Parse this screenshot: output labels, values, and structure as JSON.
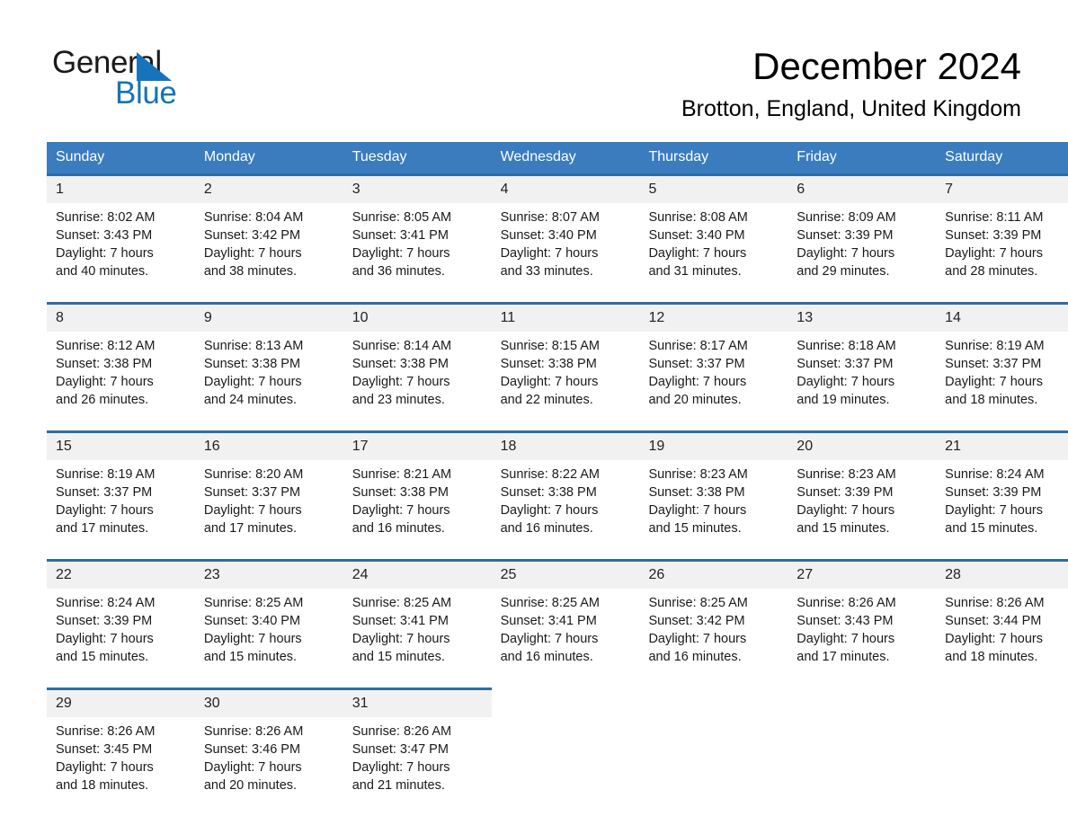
{
  "brand": {
    "name_part1": "General",
    "name_part2": "Blue",
    "triangle_color": "#1574bb"
  },
  "header": {
    "month_title": "December 2024",
    "location": "Brotton, England, United Kingdom"
  },
  "colors": {
    "header_blue": "#3a7cbe",
    "row_border_blue": "#2e6da4",
    "daynum_bg": "#f1f1f1",
    "brand_blue": "#1574bb"
  },
  "calendar": {
    "weekday_headers": [
      "Sunday",
      "Monday",
      "Tuesday",
      "Wednesday",
      "Thursday",
      "Friday",
      "Saturday"
    ],
    "weeks": [
      [
        {
          "day": "1",
          "sunrise": "Sunrise: 8:02 AM",
          "sunset": "Sunset: 3:43 PM",
          "daylight1": "Daylight: 7 hours",
          "daylight2": "and 40 minutes."
        },
        {
          "day": "2",
          "sunrise": "Sunrise: 8:04 AM",
          "sunset": "Sunset: 3:42 PM",
          "daylight1": "Daylight: 7 hours",
          "daylight2": "and 38 minutes."
        },
        {
          "day": "3",
          "sunrise": "Sunrise: 8:05 AM",
          "sunset": "Sunset: 3:41 PM",
          "daylight1": "Daylight: 7 hours",
          "daylight2": "and 36 minutes."
        },
        {
          "day": "4",
          "sunrise": "Sunrise: 8:07 AM",
          "sunset": "Sunset: 3:40 PM",
          "daylight1": "Daylight: 7 hours",
          "daylight2": "and 33 minutes."
        },
        {
          "day": "5",
          "sunrise": "Sunrise: 8:08 AM",
          "sunset": "Sunset: 3:40 PM",
          "daylight1": "Daylight: 7 hours",
          "daylight2": "and 31 minutes."
        },
        {
          "day": "6",
          "sunrise": "Sunrise: 8:09 AM",
          "sunset": "Sunset: 3:39 PM",
          "daylight1": "Daylight: 7 hours",
          "daylight2": "and 29 minutes."
        },
        {
          "day": "7",
          "sunrise": "Sunrise: 8:11 AM",
          "sunset": "Sunset: 3:39 PM",
          "daylight1": "Daylight: 7 hours",
          "daylight2": "and 28 minutes."
        }
      ],
      [
        {
          "day": "8",
          "sunrise": "Sunrise: 8:12 AM",
          "sunset": "Sunset: 3:38 PM",
          "daylight1": "Daylight: 7 hours",
          "daylight2": "and 26 minutes."
        },
        {
          "day": "9",
          "sunrise": "Sunrise: 8:13 AM",
          "sunset": "Sunset: 3:38 PM",
          "daylight1": "Daylight: 7 hours",
          "daylight2": "and 24 minutes."
        },
        {
          "day": "10",
          "sunrise": "Sunrise: 8:14 AM",
          "sunset": "Sunset: 3:38 PM",
          "daylight1": "Daylight: 7 hours",
          "daylight2": "and 23 minutes."
        },
        {
          "day": "11",
          "sunrise": "Sunrise: 8:15 AM",
          "sunset": "Sunset: 3:38 PM",
          "daylight1": "Daylight: 7 hours",
          "daylight2": "and 22 minutes."
        },
        {
          "day": "12",
          "sunrise": "Sunrise: 8:17 AM",
          "sunset": "Sunset: 3:37 PM",
          "daylight1": "Daylight: 7 hours",
          "daylight2": "and 20 minutes."
        },
        {
          "day": "13",
          "sunrise": "Sunrise: 8:18 AM",
          "sunset": "Sunset: 3:37 PM",
          "daylight1": "Daylight: 7 hours",
          "daylight2": "and 19 minutes."
        },
        {
          "day": "14",
          "sunrise": "Sunrise: 8:19 AM",
          "sunset": "Sunset: 3:37 PM",
          "daylight1": "Daylight: 7 hours",
          "daylight2": "and 18 minutes."
        }
      ],
      [
        {
          "day": "15",
          "sunrise": "Sunrise: 8:19 AM",
          "sunset": "Sunset: 3:37 PM",
          "daylight1": "Daylight: 7 hours",
          "daylight2": "and 17 minutes."
        },
        {
          "day": "16",
          "sunrise": "Sunrise: 8:20 AM",
          "sunset": "Sunset: 3:37 PM",
          "daylight1": "Daylight: 7 hours",
          "daylight2": "and 17 minutes."
        },
        {
          "day": "17",
          "sunrise": "Sunrise: 8:21 AM",
          "sunset": "Sunset: 3:38 PM",
          "daylight1": "Daylight: 7 hours",
          "daylight2": "and 16 minutes."
        },
        {
          "day": "18",
          "sunrise": "Sunrise: 8:22 AM",
          "sunset": "Sunset: 3:38 PM",
          "daylight1": "Daylight: 7 hours",
          "daylight2": "and 16 minutes."
        },
        {
          "day": "19",
          "sunrise": "Sunrise: 8:23 AM",
          "sunset": "Sunset: 3:38 PM",
          "daylight1": "Daylight: 7 hours",
          "daylight2": "and 15 minutes."
        },
        {
          "day": "20",
          "sunrise": "Sunrise: 8:23 AM",
          "sunset": "Sunset: 3:39 PM",
          "daylight1": "Daylight: 7 hours",
          "daylight2": "and 15 minutes."
        },
        {
          "day": "21",
          "sunrise": "Sunrise: 8:24 AM",
          "sunset": "Sunset: 3:39 PM",
          "daylight1": "Daylight: 7 hours",
          "daylight2": "and 15 minutes."
        }
      ],
      [
        {
          "day": "22",
          "sunrise": "Sunrise: 8:24 AM",
          "sunset": "Sunset: 3:39 PM",
          "daylight1": "Daylight: 7 hours",
          "daylight2": "and 15 minutes."
        },
        {
          "day": "23",
          "sunrise": "Sunrise: 8:25 AM",
          "sunset": "Sunset: 3:40 PM",
          "daylight1": "Daylight: 7 hours",
          "daylight2": "and 15 minutes."
        },
        {
          "day": "24",
          "sunrise": "Sunrise: 8:25 AM",
          "sunset": "Sunset: 3:41 PM",
          "daylight1": "Daylight: 7 hours",
          "daylight2": "and 15 minutes."
        },
        {
          "day": "25",
          "sunrise": "Sunrise: 8:25 AM",
          "sunset": "Sunset: 3:41 PM",
          "daylight1": "Daylight: 7 hours",
          "daylight2": "and 16 minutes."
        },
        {
          "day": "26",
          "sunrise": "Sunrise: 8:25 AM",
          "sunset": "Sunset: 3:42 PM",
          "daylight1": "Daylight: 7 hours",
          "daylight2": "and 16 minutes."
        },
        {
          "day": "27",
          "sunrise": "Sunrise: 8:26 AM",
          "sunset": "Sunset: 3:43 PM",
          "daylight1": "Daylight: 7 hours",
          "daylight2": "and 17 minutes."
        },
        {
          "day": "28",
          "sunrise": "Sunrise: 8:26 AM",
          "sunset": "Sunset: 3:44 PM",
          "daylight1": "Daylight: 7 hours",
          "daylight2": "and 18 minutes."
        }
      ],
      [
        {
          "day": "29",
          "sunrise": "Sunrise: 8:26 AM",
          "sunset": "Sunset: 3:45 PM",
          "daylight1": "Daylight: 7 hours",
          "daylight2": "and 18 minutes."
        },
        {
          "day": "30",
          "sunrise": "Sunrise: 8:26 AM",
          "sunset": "Sunset: 3:46 PM",
          "daylight1": "Daylight: 7 hours",
          "daylight2": "and 20 minutes."
        },
        {
          "day": "31",
          "sunrise": "Sunrise: 8:26 AM",
          "sunset": "Sunset: 3:47 PM",
          "daylight1": "Daylight: 7 hours",
          "daylight2": "and 21 minutes."
        },
        {
          "day": "",
          "sunrise": "",
          "sunset": "",
          "daylight1": "",
          "daylight2": ""
        },
        {
          "day": "",
          "sunrise": "",
          "sunset": "",
          "daylight1": "",
          "daylight2": ""
        },
        {
          "day": "",
          "sunrise": "",
          "sunset": "",
          "daylight1": "",
          "daylight2": ""
        },
        {
          "day": "",
          "sunrise": "",
          "sunset": "",
          "daylight1": "",
          "daylight2": ""
        }
      ]
    ]
  }
}
